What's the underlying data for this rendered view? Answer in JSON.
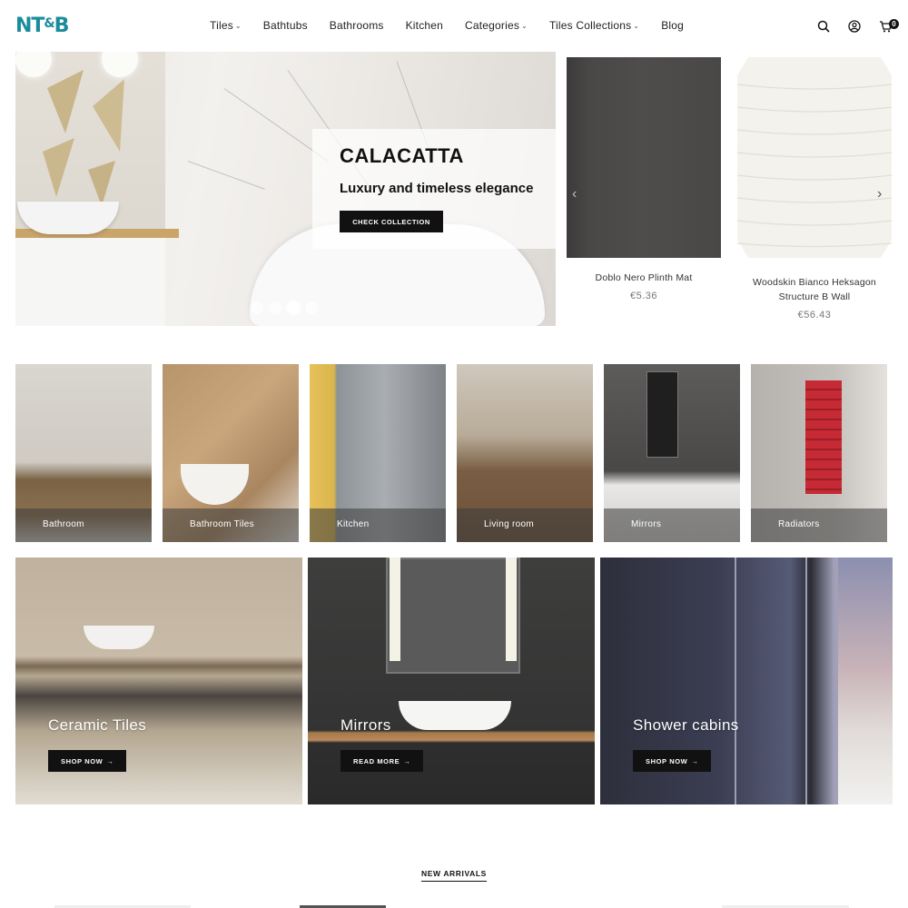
{
  "header": {
    "logo_main": "NT",
    "logo_amp": "&",
    "logo_end": "B",
    "nav": [
      {
        "label": "Tiles",
        "has_dropdown": true
      },
      {
        "label": "Bathtubs",
        "has_dropdown": false
      },
      {
        "label": "Bathrooms",
        "has_dropdown": false
      },
      {
        "label": "Kitchen",
        "has_dropdown": false
      },
      {
        "label": "Categories",
        "has_dropdown": true
      },
      {
        "label": "Tiles Collections",
        "has_dropdown": true
      },
      {
        "label": "Blog",
        "has_dropdown": false
      }
    ],
    "icons": [
      "search-icon",
      "user-icon",
      "cart-icon"
    ],
    "cart_count": "0"
  },
  "hero": {
    "title": "CALACATTA",
    "subtitle": "Luxury and timeless elegance",
    "button": "CHECK COLLECTION",
    "slides": 4,
    "active_slide": 3
  },
  "products": [
    {
      "name": "Doblo Nero Plinth Mat",
      "price": "€5.36"
    },
    {
      "name": "Woodskin Bianco Heksagon Structure B Wall",
      "price": "€56.43"
    }
  ],
  "categories": [
    {
      "label": "Bathroom"
    },
    {
      "label": "Bathroom Tiles"
    },
    {
      "label": "Kitchen"
    },
    {
      "label": "Living room"
    },
    {
      "label": "Mirrors"
    },
    {
      "label": "Radiators"
    }
  ],
  "promos": [
    {
      "title": "Ceramic Tiles",
      "button": "SHOP NOW"
    },
    {
      "title": "Mirrors",
      "button": "READ MORE"
    },
    {
      "title": "Shower cabins",
      "button": "SHOP NOW"
    }
  ],
  "new_arrivals": {
    "label": "NEW ARRIVALS"
  },
  "colors": {
    "brand": "#1a8c9b",
    "button": "#111111"
  }
}
